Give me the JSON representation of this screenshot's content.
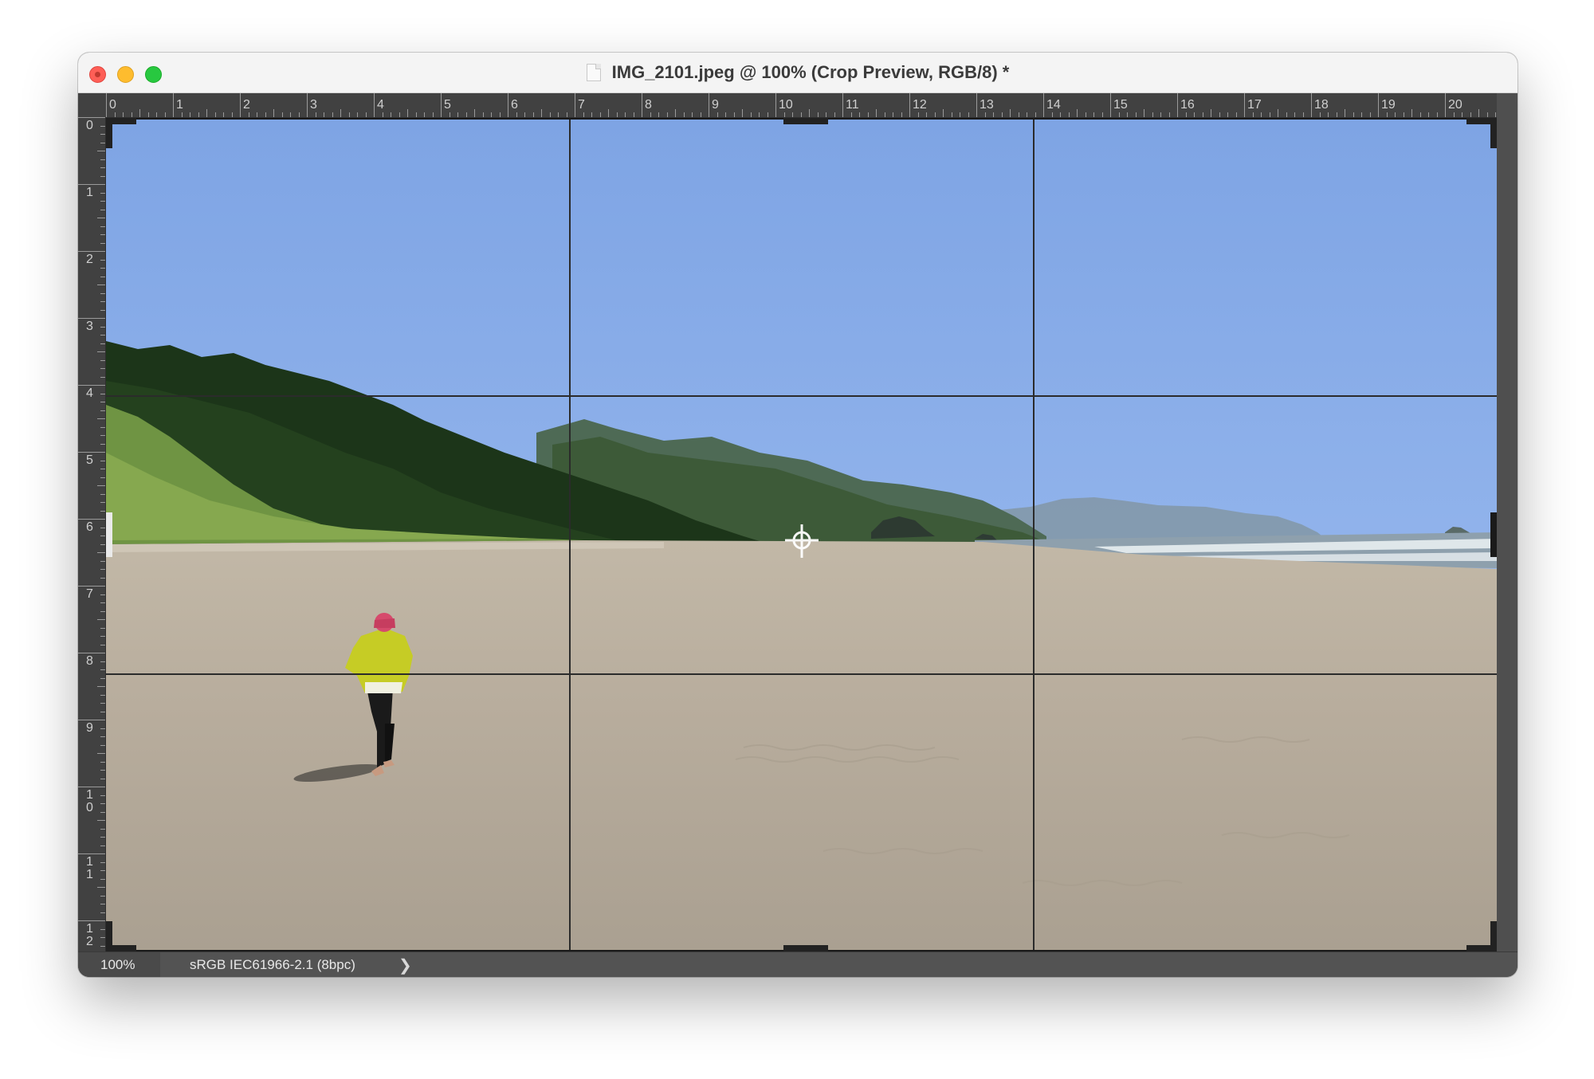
{
  "window": {
    "title": "IMG_2101.jpeg @ 100% (Crop Preview, RGB/8) *"
  },
  "rulers": {
    "top_labels": [
      "0",
      "1",
      "2",
      "3",
      "4",
      "5",
      "6",
      "7",
      "8",
      "9",
      "10",
      "11",
      "12",
      "13",
      "14",
      "15",
      "16",
      "17",
      "18",
      "19",
      "20"
    ],
    "left_labels": [
      "0",
      "1",
      "2",
      "3",
      "4",
      "5",
      "6",
      "7",
      "8",
      "9",
      "1\n0",
      "1\n1",
      "1\n2"
    ]
  },
  "status": {
    "zoom": "100%",
    "color_profile": "sRGB IEC61966-2.1 (8bpc)",
    "arrow": "❯"
  },
  "colors": {
    "sky_top": "#7ba3e6",
    "sky_bottom": "#a9c6ef",
    "sand": "#b6ab9c",
    "forest": "#1f3d1c",
    "jacket": "#c9cf2a"
  }
}
